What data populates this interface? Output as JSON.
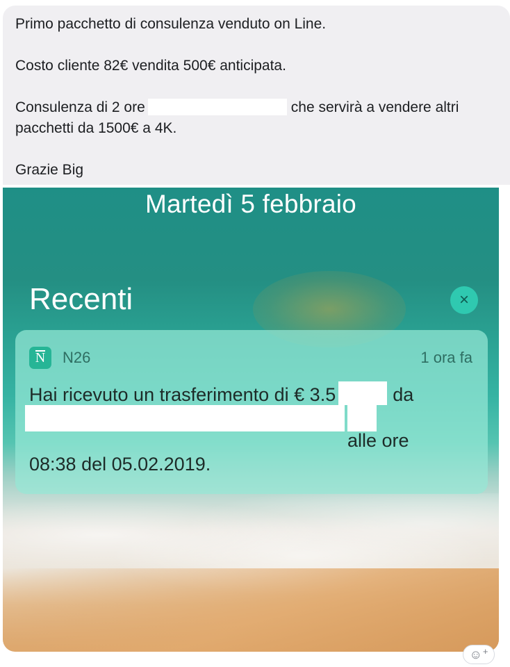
{
  "message": {
    "line1": "Primo pacchetto di consulenza venduto on Line.",
    "line2": "Costo cliente 82€ vendita 500€ anticipata.",
    "line3_start": "Consulenza di 2 ore",
    "line3_end": "che servirà a vendere altri",
    "line4": "pacchetti da 1500€ a 4K.",
    "line5": "Grazie Big"
  },
  "screenshot": {
    "date": "Martedì 5 febbraio",
    "section_title": "Recenti",
    "clear_icon": "×",
    "notification": {
      "app_icon_letter": "N",
      "app_name": "N26",
      "time_ago": "1 ora fa",
      "body_line1_start": "Hai ricevuto un trasferimento di € 3.5",
      "body_line1_end": "da",
      "body_line3_end": "alle ore",
      "body_line4": "08:38 del 05.02.2019."
    }
  },
  "reaction": {
    "icon": "☺",
    "plus": "+"
  }
}
